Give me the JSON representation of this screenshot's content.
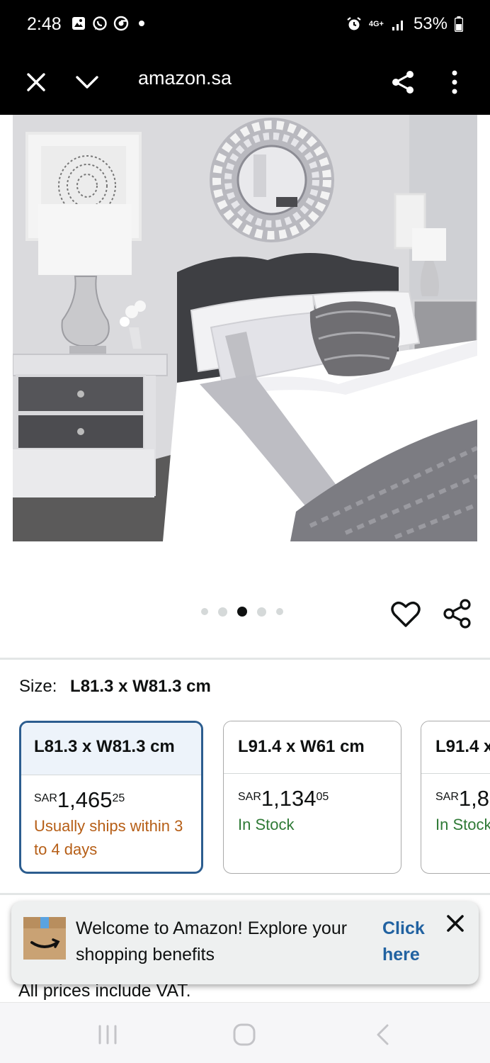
{
  "status_bar": {
    "time": "2:48",
    "battery": "53%",
    "network": "4G+",
    "icons": [
      "gallery-icon",
      "whatsapp-icon",
      "chrome-icon",
      "alarm-icon",
      "signal-icon",
      "battery-icon"
    ]
  },
  "browser": {
    "url": "amazon.sa",
    "icons": [
      "close-icon",
      "chevron-down-icon",
      "share-icon",
      "more-vert-icon"
    ]
  },
  "carousel": {
    "dot_count": 5,
    "active_index": 2
  },
  "size": {
    "label": "Size:",
    "selected_value": "L81.3 x W81.3 cm"
  },
  "options": [
    {
      "title": "L81.3 x W81.3 cm",
      "currency": "SAR",
      "price_main": "1,465",
      "price_frac": "25",
      "availability": "Usually ships within 3 to 4 days",
      "availability_color": "#b65e16",
      "selected": true
    },
    {
      "title": "L91.4 x W61 cm",
      "currency": "SAR",
      "price_main": "1,134",
      "price_frac": "05",
      "availability": "In Stock",
      "availability_color": "#2f7a36",
      "selected": false
    },
    {
      "title": "L91.4 x",
      "currency": "SAR",
      "price_main": "1,8",
      "price_frac": "",
      "availability": "In Stock",
      "availability_color": "#2f7a36",
      "selected": false
    }
  ],
  "vat_note": "All prices include VAT.",
  "welcome_banner": {
    "message": "Welcome to Amazon! Explore your shopping benefits",
    "cta": "Click here"
  },
  "colors": {
    "selected_border": "#2c5d8f",
    "link": "#2162a1",
    "status_bar_bg": "#000000"
  }
}
